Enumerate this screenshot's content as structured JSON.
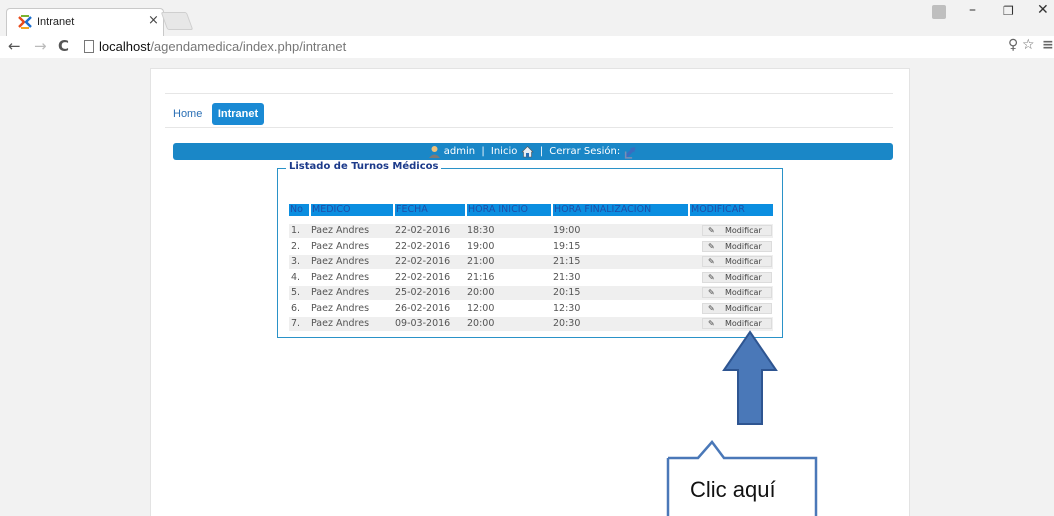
{
  "browser": {
    "tab_title": "Intranet",
    "tab_close": "×",
    "url_host": "localhost",
    "url_path": "/agendamedica/index.php/intranet"
  },
  "nav": {
    "home": "Home",
    "intranet": "Intranet"
  },
  "userbar": {
    "user": "admin",
    "separator1": "|",
    "inicio": "Inicio",
    "separator2": "|",
    "cerrar": "Cerrar Sesión:"
  },
  "table": {
    "legend": "Listado de Turnos Médicos",
    "headers": [
      "No",
      "MEDICO",
      "FECHA",
      "HORA INICIO",
      "HORA FINALIZACION",
      "MODIFICAR"
    ],
    "rows": [
      {
        "no": "1.",
        "medico": "Paez Andres",
        "fecha": "22-02-2016",
        "inicio": "18:30",
        "fin": "19:00",
        "action": "Modificar"
      },
      {
        "no": "2.",
        "medico": "Paez Andres",
        "fecha": "22-02-2016",
        "inicio": "19:00",
        "fin": "19:15",
        "action": "Modificar"
      },
      {
        "no": "3.",
        "medico": "Paez Andres",
        "fecha": "22-02-2016",
        "inicio": "21:00",
        "fin": "21:15",
        "action": "Modificar"
      },
      {
        "no": "4.",
        "medico": "Paez Andres",
        "fecha": "22-02-2016",
        "inicio": "21:16",
        "fin": "21:30",
        "action": "Modificar"
      },
      {
        "no": "5.",
        "medico": "Paez Andres",
        "fecha": "25-02-2016",
        "inicio": "20:00",
        "fin": "20:15",
        "action": "Modificar"
      },
      {
        "no": "6.",
        "medico": "Paez Andres",
        "fecha": "26-02-2016",
        "inicio": "12:00",
        "fin": "12:30",
        "action": "Modificar"
      },
      {
        "no": "7.",
        "medico": "Paez Andres",
        "fecha": "09-03-2016",
        "inicio": "20:00",
        "fin": "20:30",
        "action": "Modificar"
      }
    ]
  },
  "annotation": {
    "callout_text": "Clic aquí"
  },
  "colors": {
    "accent": "#1a87c7",
    "header_bg": "#0b8ee0",
    "arrow": "#4a78b8"
  }
}
